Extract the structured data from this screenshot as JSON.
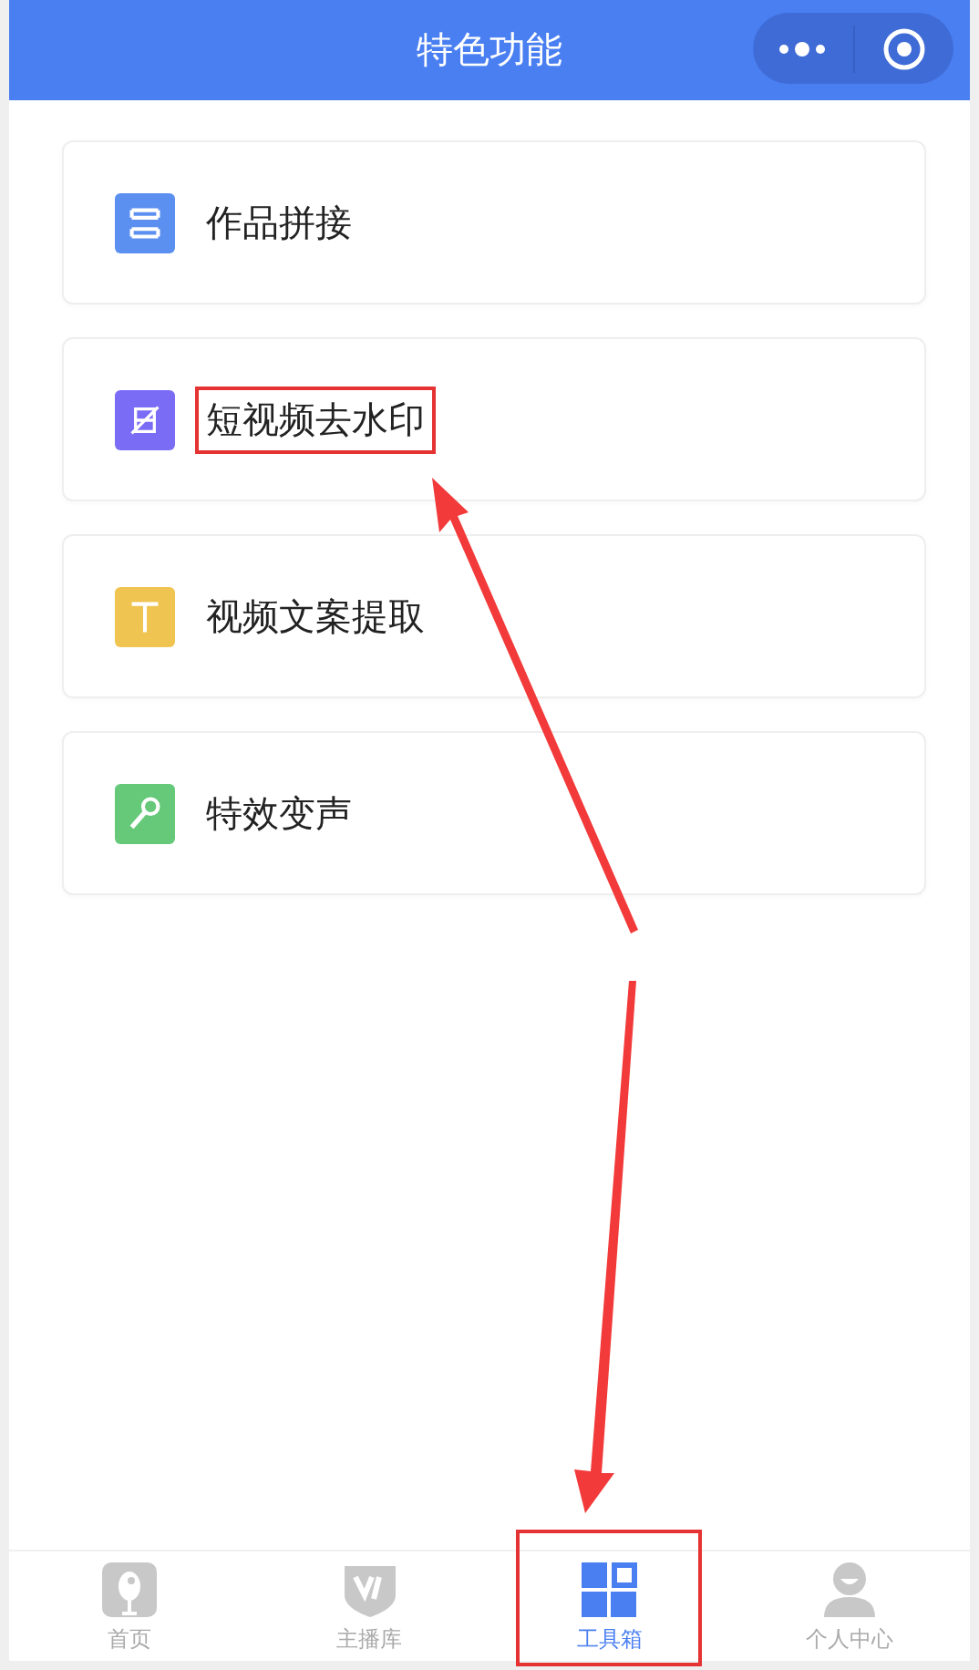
{
  "header": {
    "title": "特色功能"
  },
  "features": [
    {
      "label": "作品拼接",
      "color": "#5b8ff0",
      "highlighted": false
    },
    {
      "label": "短视频去水印",
      "color": "#7b6cf6",
      "highlighted": true
    },
    {
      "label": "视频文案提取",
      "color": "#f0c451",
      "highlighted": false
    },
    {
      "label": "特效变声",
      "color": "#66c97a",
      "highlighted": false
    }
  ],
  "tabs": [
    {
      "label": "首页",
      "selected": false,
      "highlighted": false
    },
    {
      "label": "主播库",
      "selected": false,
      "highlighted": false
    },
    {
      "label": "工具箱",
      "selected": true,
      "highlighted": true
    },
    {
      "label": "个人中心",
      "selected": false,
      "highlighted": false
    }
  ]
}
